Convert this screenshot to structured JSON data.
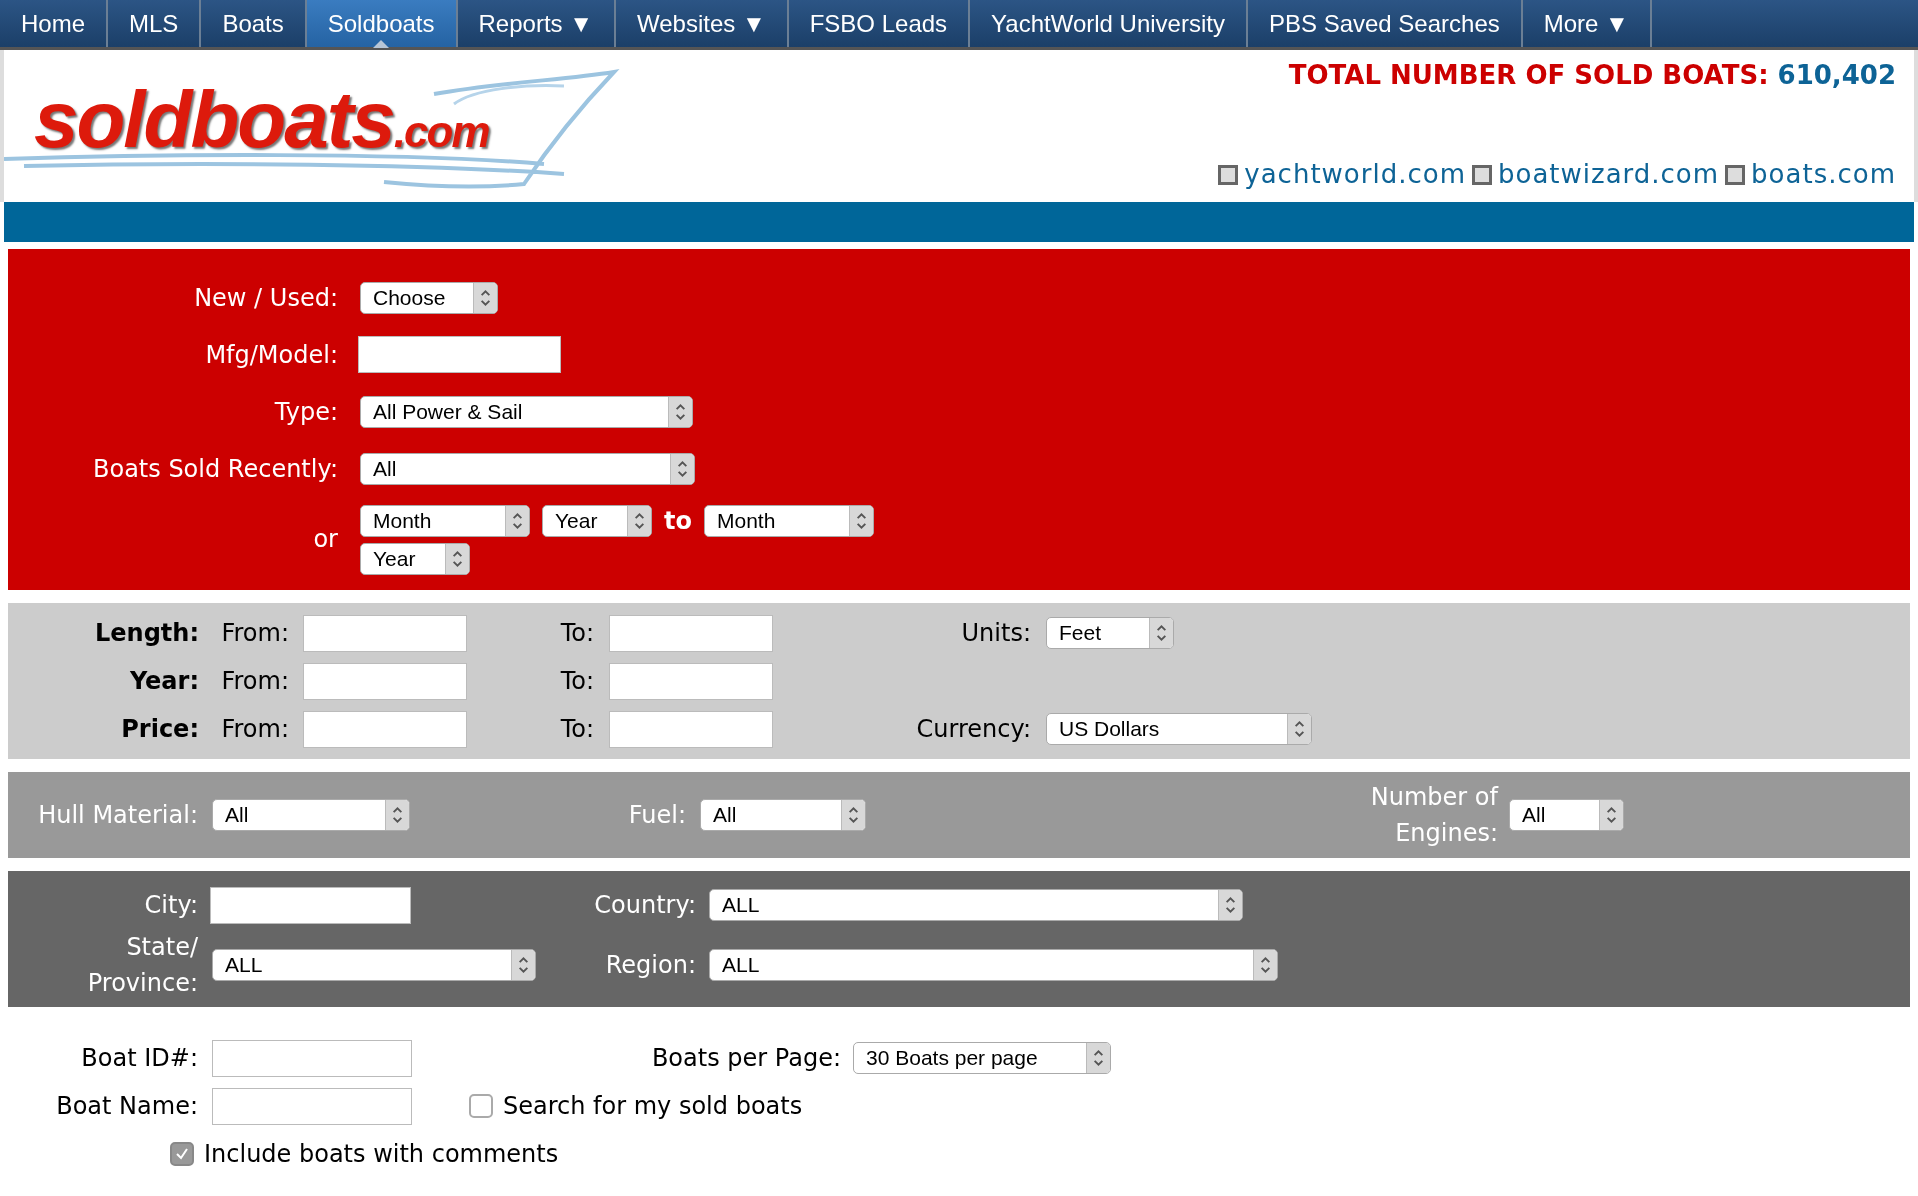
{
  "nav": [
    {
      "label": "Home",
      "selected": false
    },
    {
      "label": "MLS",
      "selected": false
    },
    {
      "label": "Boats",
      "selected": false
    },
    {
      "label": "Soldboats",
      "selected": true
    },
    {
      "label": "Reports ▼",
      "selected": false
    },
    {
      "label": "Websites ▼",
      "selected": false
    },
    {
      "label": "FSBO Leads",
      "selected": false
    },
    {
      "label": "YachtWorld University",
      "selected": false
    },
    {
      "label": "PBS Saved Searches",
      "selected": false
    },
    {
      "label": "More ▼",
      "selected": false
    }
  ],
  "logo": {
    "name": "soldboats",
    "suffix": ".com"
  },
  "total": {
    "label": "TOTAL NUMBER OF SOLD BOATS:",
    "value": "610,402"
  },
  "sites": [
    "yachtworld.com",
    "boatwizard.com",
    "boats.com"
  ],
  "basic": {
    "new_used": {
      "label": "New / Used:",
      "value": "Choose"
    },
    "mfg_model": {
      "label": "Mfg/Model:"
    },
    "type": {
      "label": "Type:",
      "value": "All Power & Sail"
    },
    "sold_recently": {
      "label": "Boats Sold Recently:",
      "value": "All"
    },
    "range": {
      "label": "or",
      "from_month": "Month",
      "from_year": "Year",
      "to": "to",
      "to_month": "Month",
      "to_year": "Year"
    }
  },
  "ranges": [
    {
      "label": "Length:",
      "from": "From:",
      "to": "To:",
      "setting": {
        "label": "Units:",
        "value": "Feet"
      }
    },
    {
      "label": "Year:",
      "from": "From:",
      "to": "To:"
    },
    {
      "label": "Price:",
      "from": "From:",
      "to": "To:",
      "setting": {
        "label": "Currency:",
        "value": "US Dollars"
      }
    }
  ],
  "specs": {
    "hull": {
      "label": "Hull Material:",
      "value": "All"
    },
    "fuel": {
      "label": "Fuel:",
      "value": "All"
    },
    "engines": {
      "label": "Number of Engines:",
      "value": "All"
    }
  },
  "location": {
    "city": {
      "label": "City:"
    },
    "country": {
      "label": "Country:",
      "value": "ALL"
    },
    "state": {
      "label": "State/ Province:",
      "value": "ALL"
    },
    "region": {
      "label": "Region:",
      "value": "ALL"
    }
  },
  "extra": {
    "boat_id": {
      "label": "Boat ID#:"
    },
    "per_page": {
      "label": "Boats per Page:",
      "value": "30 Boats per page"
    },
    "boat_name": {
      "label": "Boat Name:"
    },
    "checkboxes": [
      {
        "label": "Search for my sold boats",
        "checked": false,
        "disabled": false
      },
      {
        "label": "Include boats with comments",
        "checked": true,
        "disabled": true
      }
    ]
  }
}
